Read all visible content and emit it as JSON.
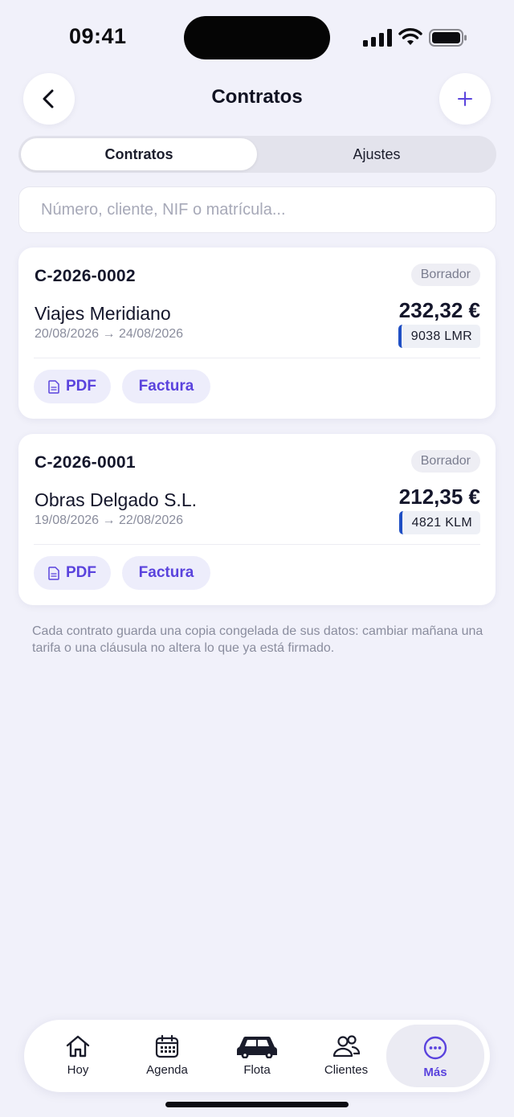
{
  "status_bar": {
    "time": "09:41"
  },
  "header": {
    "title": "Contratos",
    "back_icon": "chevron-left-icon",
    "add_icon": "plus-icon"
  },
  "segmented": {
    "active": "Contratos",
    "inactive": "Ajustes"
  },
  "search": {
    "placeholder": "Número, cliente, NIF o matrícula...",
    "value": ""
  },
  "contracts": [
    {
      "number": "C-2026-0002",
      "status": "Borrador",
      "client": "Viajes Meridiano",
      "dates": "20/08/2026 → 24/08/2026",
      "amount": "232,32 €",
      "plate": "9038 LMR",
      "pdf_label": "PDF",
      "invoice_label": "Factura"
    },
    {
      "number": "C-2026-0001",
      "status": "Borrador",
      "client": "Obras Delgado S.L.",
      "dates": "19/08/2026 → 22/08/2026",
      "amount": "212,35 €",
      "plate": "4821 KLM",
      "pdf_label": "PDF",
      "invoice_label": "Factura"
    }
  ],
  "note": "Cada contrato guarda una copia congelada de sus datos: cambiar mañana una tarifa o una cláusula no altera lo que ya está firmado.",
  "tabbar": {
    "items": [
      {
        "label": "Hoy",
        "icon": "home-icon",
        "active": false
      },
      {
        "label": "Agenda",
        "icon": "calendar-icon",
        "active": false
      },
      {
        "label": "Flota",
        "icon": "car-icon",
        "active": false
      },
      {
        "label": "Clientes",
        "icon": "users-icon",
        "active": false
      },
      {
        "label": "Más",
        "icon": "more-icon",
        "active": true
      }
    ]
  },
  "colors": {
    "accent": "#5a43dd",
    "plate_stripe": "#1f4fc4",
    "background": "#f1f1fa"
  }
}
